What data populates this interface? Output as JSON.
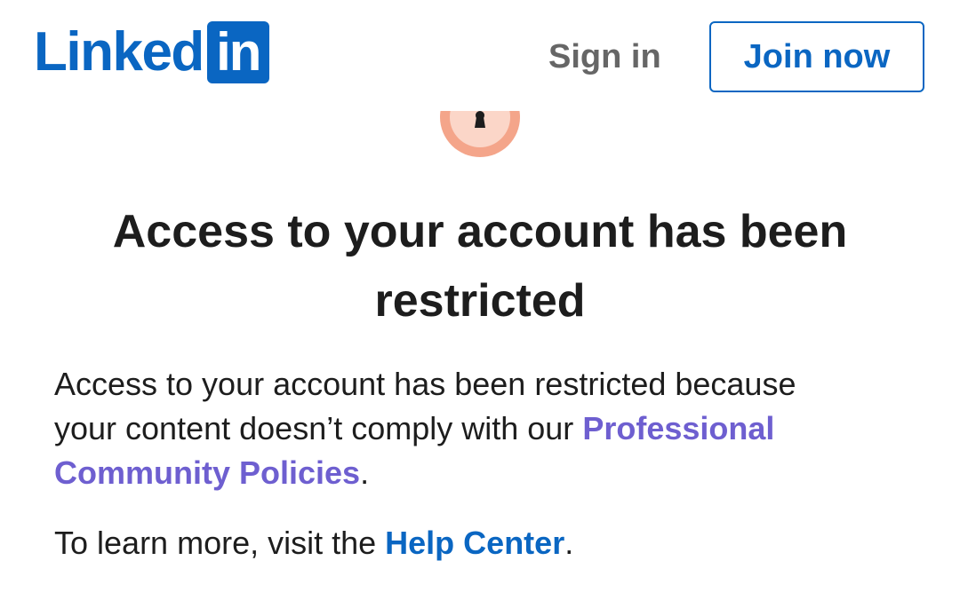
{
  "header": {
    "logo_text": "Linked",
    "logo_box_text": "in",
    "signin_label": "Sign in",
    "join_label": "Join now"
  },
  "colors": {
    "brand": "#0a66c2",
    "policy_link": "#6e5fd0",
    "illustration_outer": "#f4a58a",
    "illustration_inner": "#fbd6c8"
  },
  "illustration": {
    "icon": "lock-icon"
  },
  "main": {
    "title": "Access to your account has been restricted",
    "paragraph1_prefix": "Access to your account has been restricted because your content doesn’t comply with our ",
    "policy_link": "Professional Community Policies",
    "paragraph1_suffix": ".",
    "paragraph2_prefix": "To learn more, visit the ",
    "help_link": "Help Center",
    "paragraph2_suffix": "."
  }
}
